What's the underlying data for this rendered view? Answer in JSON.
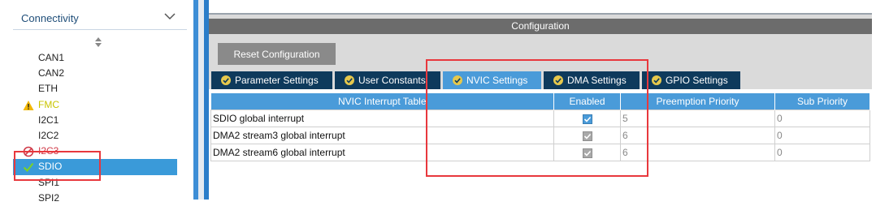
{
  "sidebar": {
    "category": "Connectivity",
    "items": [
      {
        "label": "CAN1",
        "status": ""
      },
      {
        "label": "CAN2",
        "status": ""
      },
      {
        "label": "ETH",
        "status": ""
      },
      {
        "label": "FMC",
        "status": "warning"
      },
      {
        "label": "I2C1",
        "status": ""
      },
      {
        "label": "I2C2",
        "status": ""
      },
      {
        "label": "I2C3",
        "status": "error"
      },
      {
        "label": "SDIO",
        "status": "ok-selected"
      },
      {
        "label": "SPI1",
        "status": ""
      },
      {
        "label": "SPI2",
        "status": ""
      }
    ]
  },
  "config": {
    "header": "Configuration",
    "reset_label": "Reset Configuration",
    "tabs": [
      {
        "label": "Parameter Settings",
        "active": false
      },
      {
        "label": "User Constants",
        "active": false
      },
      {
        "label": "NVIC Settings",
        "active": true
      },
      {
        "label": "DMA Settings",
        "active": false
      },
      {
        "label": "GPIO Settings",
        "active": false
      }
    ],
    "table": {
      "headers": [
        "NVIC Interrupt Table",
        "Enabled",
        "Preemption Priority",
        "Sub Priority"
      ],
      "rows": [
        {
          "name": "SDIO global interrupt",
          "enabled": true,
          "preemption": "5",
          "sub": "0"
        },
        {
          "name": "DMA2 stream3 global interrupt",
          "enabled": true,
          "preemption": "6",
          "sub": "0"
        },
        {
          "name": "DMA2 stream6 global interrupt",
          "enabled": true,
          "preemption": "6",
          "sub": "0"
        }
      ]
    }
  },
  "colors": {
    "accent": "#4a9bd9",
    "tab_dark": "#0e3a5c",
    "highlight": "#e8383d",
    "selected": "#3a9ad9"
  }
}
